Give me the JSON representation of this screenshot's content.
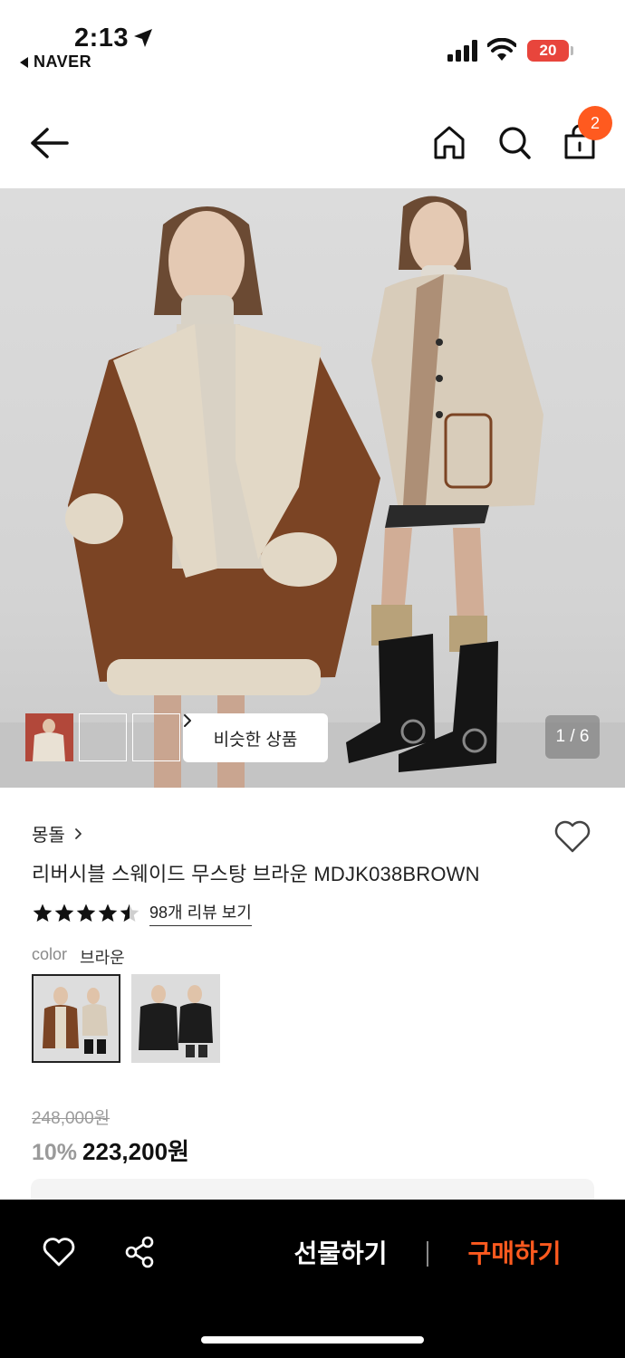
{
  "status_bar": {
    "time": "2:13",
    "back_app": "NAVER",
    "battery": "20"
  },
  "header": {
    "cart_count": "2",
    "icons": [
      "back-arrow-icon",
      "home-icon",
      "search-icon",
      "shopping-bag-icon"
    ]
  },
  "gallery": {
    "similar_label": "비슷한 상품",
    "page": "1 / 6",
    "thumbnail_colors": [
      "#c79a55",
      "#d8c6a8",
      "#b2483a"
    ]
  },
  "product": {
    "brand": "몽돌",
    "name": "리버시블 스웨이드 무스탕 브라운 MDJK038BROWN",
    "rating": 4.5,
    "review_link": "98개 리뷰 보기",
    "color_label": "color",
    "color_value": "브라운",
    "original_price": "248,000원",
    "discount": "10%",
    "sale_price": "223,200원"
  },
  "bottom_bar": {
    "gift_label": "선물하기",
    "buy_label": "구매하기"
  },
  "colors": {
    "accent": "#ff5a1f",
    "bottom_bar_bg": "#000000"
  }
}
